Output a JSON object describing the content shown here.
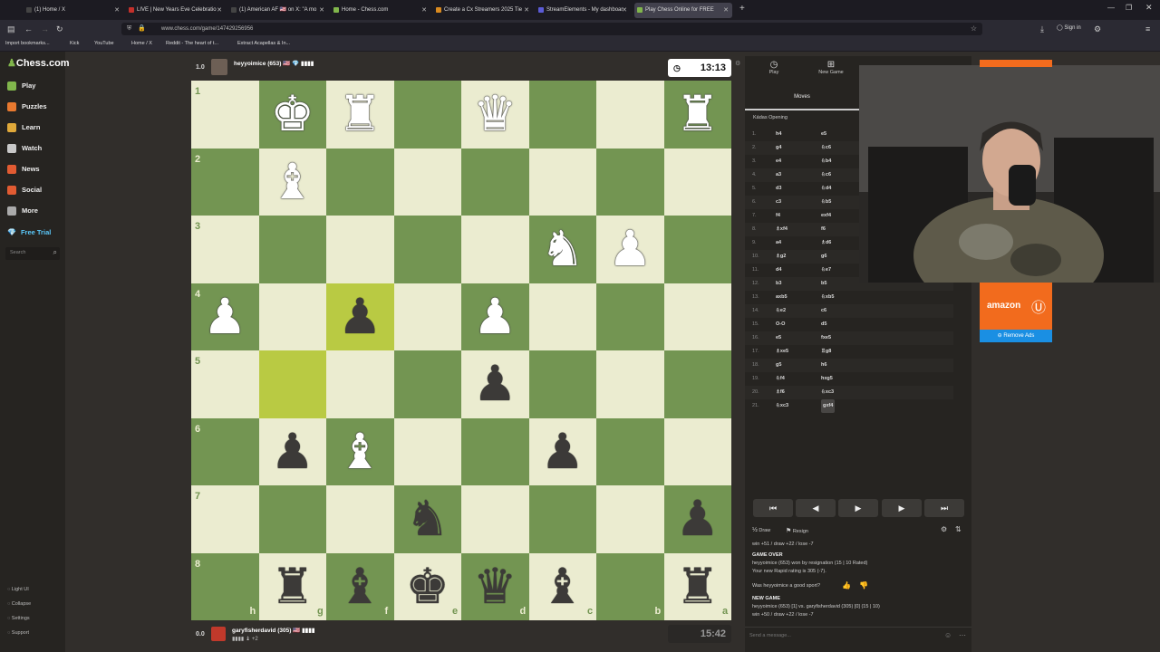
{
  "browser": {
    "tabs": [
      {
        "title": "(1) Home / X",
        "color": "#444"
      },
      {
        "title": "LIVE | New Years Eve Celebratio",
        "color": "#c4302b"
      },
      {
        "title": "(1) American AF 🇺🇸 on X: \"A mo",
        "color": "#444"
      },
      {
        "title": "Home - Chess.com",
        "color": "#81b64c"
      },
      {
        "title": "Create a Cx Streamers 2025 Tie",
        "color": "#d98a1f"
      },
      {
        "title": "StreamElements - My dashboar",
        "color": "#5b5bd6"
      },
      {
        "title": "Play Chess Online for FREE",
        "color": "#81b64c"
      }
    ],
    "url": "www.chess.com/game/147429256956",
    "signin": "Sign in",
    "bookmarks": [
      "Import bookmarks...",
      "Kick",
      "YouTube",
      "Home / X",
      "Reddit - The heart of t...",
      "Extract Acapellas & In..."
    ]
  },
  "sidebar": {
    "logo": "Chess.com",
    "items": [
      {
        "label": "Play",
        "color": "#81b64c"
      },
      {
        "label": "Puzzles",
        "color": "#e8792f"
      },
      {
        "label": "Learn",
        "color": "#e0a93a"
      },
      {
        "label": "Watch",
        "color": "#c8c8c8"
      },
      {
        "label": "News",
        "color": "#e25b32"
      },
      {
        "label": "Social",
        "color": "#e25b32"
      },
      {
        "label": "More",
        "color": "#aaa"
      }
    ],
    "free_trial": "Free Trial",
    "search_placeholder": "Search",
    "bottom": [
      "Light UI",
      "Collapse",
      "Settings",
      "Support"
    ]
  },
  "top_player": {
    "score": "1.0",
    "name": "heyyoimice (653) 🇺🇸 💎 ▮▮▮▮",
    "clock": "13:13"
  },
  "bottom_player": {
    "score": "0.0",
    "name": "garyfisherdavid (305) 🇺🇸 ▮▮▮▮",
    "material": "▮▮▮▮ ♝ +2",
    "clock": "15:42"
  },
  "board": {
    "ranks": [
      "1",
      "2",
      "3",
      "4",
      "5",
      "6",
      "7",
      "8"
    ],
    "files": [
      "h",
      "g",
      "f",
      "e",
      "d",
      "c",
      "b",
      "a"
    ],
    "highlights": [
      {
        "row": 3,
        "col": 2
      },
      {
        "row": 4,
        "col": 1
      }
    ],
    "pieces": [
      {
        "row": 0,
        "col": 1,
        "glyph": "♚",
        "color": "w"
      },
      {
        "row": 0,
        "col": 2,
        "glyph": "♜",
        "color": "w"
      },
      {
        "row": 0,
        "col": 4,
        "glyph": "♛",
        "color": "w"
      },
      {
        "row": 0,
        "col": 7,
        "glyph": "♜",
        "color": "w"
      },
      {
        "row": 1,
        "col": 1,
        "glyph": "♝",
        "color": "w"
      },
      {
        "row": 2,
        "col": 5,
        "glyph": "♞",
        "color": "w"
      },
      {
        "row": 2,
        "col": 6,
        "glyph": "♟",
        "color": "w"
      },
      {
        "row": 3,
        "col": 0,
        "glyph": "♟",
        "color": "w"
      },
      {
        "row": 3,
        "col": 2,
        "glyph": "♟",
        "color": "b"
      },
      {
        "row": 3,
        "col": 4,
        "glyph": "♟",
        "color": "w"
      },
      {
        "row": 4,
        "col": 4,
        "glyph": "♟",
        "color": "b"
      },
      {
        "row": 5,
        "col": 1,
        "glyph": "♟",
        "color": "b"
      },
      {
        "row": 5,
        "col": 2,
        "glyph": "♝",
        "color": "w"
      },
      {
        "row": 5,
        "col": 5,
        "glyph": "♟",
        "color": "b"
      },
      {
        "row": 6,
        "col": 3,
        "glyph": "♞",
        "color": "b"
      },
      {
        "row": 6,
        "col": 7,
        "glyph": "♟",
        "color": "b"
      },
      {
        "row": 7,
        "col": 1,
        "glyph": "♜",
        "color": "b"
      },
      {
        "row": 7,
        "col": 2,
        "glyph": "♝",
        "color": "b"
      },
      {
        "row": 7,
        "col": 3,
        "glyph": "♚",
        "color": "b"
      },
      {
        "row": 7,
        "col": 4,
        "glyph": "♛",
        "color": "b"
      },
      {
        "row": 7,
        "col": 5,
        "glyph": "♝",
        "color": "b"
      },
      {
        "row": 7,
        "col": 7,
        "glyph": "♜",
        "color": "b"
      }
    ]
  },
  "panel": {
    "tabs": [
      "Play",
      "New Game"
    ],
    "moves_tab": "Moves",
    "opening": "Kádas Opening",
    "moves": [
      {
        "n": "1.",
        "w": "h4",
        "b": "e5"
      },
      {
        "n": "2.",
        "w": "g4",
        "b": "♘c6"
      },
      {
        "n": "3.",
        "w": "e4",
        "b": "♘b4"
      },
      {
        "n": "4.",
        "w": "a3",
        "b": "♘c6"
      },
      {
        "n": "5.",
        "w": "d3",
        "b": "♘d4"
      },
      {
        "n": "6.",
        "w": "c3",
        "b": "♘b5"
      },
      {
        "n": "7.",
        "w": "f4",
        "b": "exf4"
      },
      {
        "n": "8.",
        "w": "♗xf4",
        "b": "f6"
      },
      {
        "n": "9.",
        "w": "a4",
        "b": "♗d6"
      },
      {
        "n": "10.",
        "w": "♗g2",
        "b": "g6"
      },
      {
        "n": "11.",
        "w": "d4",
        "b": "♘e7"
      },
      {
        "n": "12.",
        "w": "b3",
        "b": "b5"
      },
      {
        "n": "13.",
        "w": "axb5",
        "b": "♘xb5"
      },
      {
        "n": "14.",
        "w": "♘e2",
        "b": "c6"
      },
      {
        "n": "15.",
        "w": "O-O",
        "b": "d5"
      },
      {
        "n": "16.",
        "w": "e5",
        "b": "fxe5"
      },
      {
        "n": "17.",
        "w": "♗xe5",
        "b": "♖g8"
      },
      {
        "n": "18.",
        "w": "g5",
        "b": "h6"
      },
      {
        "n": "19.",
        "w": "♘f4",
        "b": "hxg5"
      },
      {
        "n": "20.",
        "w": "♗f6",
        "b": "♘xc3"
      },
      {
        "n": "21.",
        "w": "♘xc3",
        "b": "gxf4"
      }
    ],
    "draw": "Draw",
    "resign": "Resign",
    "record_line": "win +51 / draw +22 / lose -7",
    "game_over": "GAME OVER",
    "result": "heyyoimice (653) won by resignation (15 | 10 Rated)",
    "rating": "Your new Rapid rating is 305 (-7).",
    "good_sport": "Was heyyoimice a good sport?",
    "new_game": "NEW GAME",
    "new_game_line": "heyyoimice (653) [1] vs. garyfisherdavid (305) [0] (15 | 10)",
    "new_record": "win +50 / draw +22 / lose -7",
    "message_placeholder": "Send a message..."
  },
  "ad": {
    "brand": "amazon",
    "remove": "Remove Ads"
  }
}
